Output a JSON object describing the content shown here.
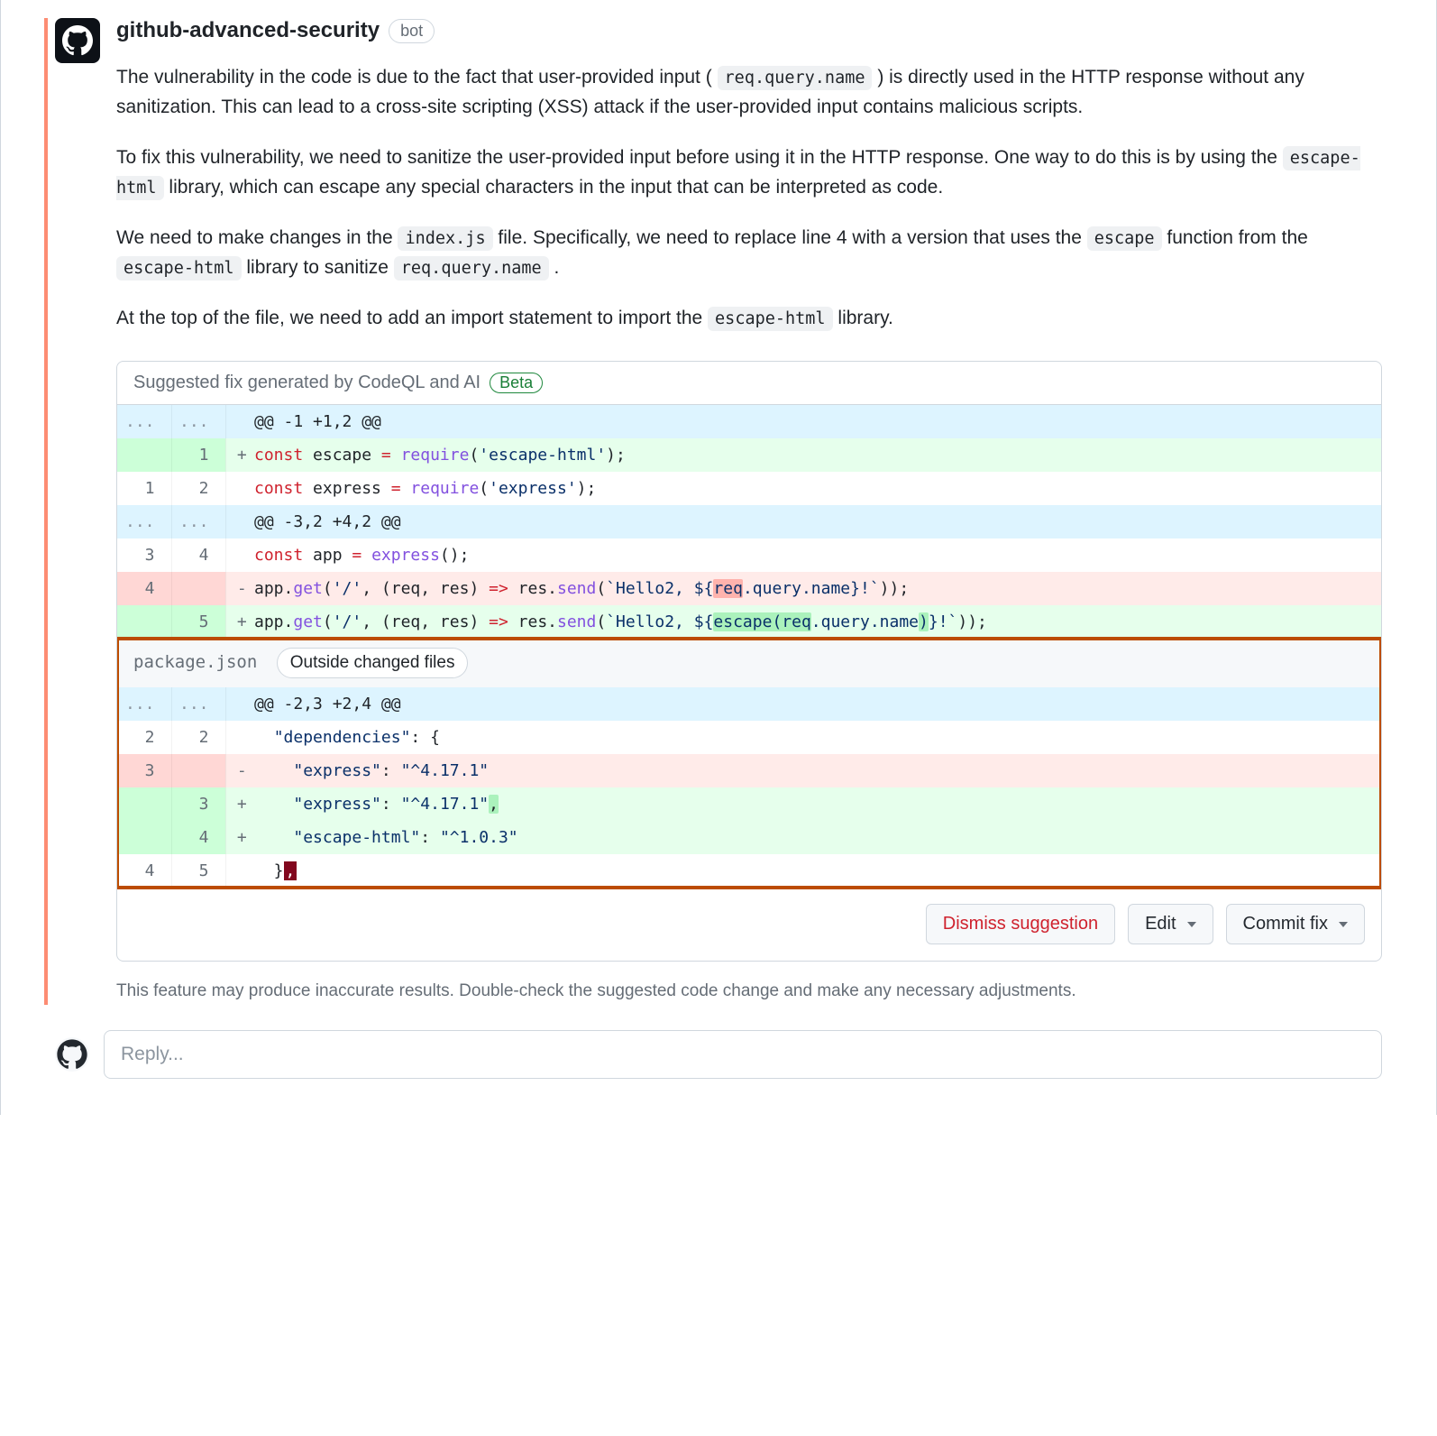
{
  "author": {
    "name": "github-advanced-security",
    "badge": "bot"
  },
  "body": {
    "p1a": "The vulnerability in the code is due to the fact that user-provided input ( ",
    "p1_code": "req.query.name",
    "p1b": " ) is directly used in the HTTP response without any sanitization. This can lead to a cross-site scripting (XSS) attack if the user-provided input contains malicious scripts.",
    "p2a": "To fix this vulnerability, we need to sanitize the user-provided input before using it in the HTTP response. One way to do this is by using the ",
    "p2_code": "escape-html",
    "p2b": " library, which can escape any special characters in the input that can be interpreted as code.",
    "p3a": "We need to make changes in the ",
    "p3_code1": "index.js",
    "p3b": " file. Specifically, we need to replace line 4 with a version that uses the ",
    "p3_code2": "escape",
    "p3c": " function from the ",
    "p3_code3": "escape-html",
    "p3d": " library to sanitize ",
    "p3_code4": "req.query.name",
    "p3e": " .",
    "p4a": "At the top of the file, we need to add an import statement to import the ",
    "p4_code": "escape-html",
    "p4b": " library."
  },
  "diff": {
    "header": "Suggested fix generated by CodeQL and AI",
    "beta": "Beta",
    "file2": "package.json",
    "outside_label": "Outside changed files",
    "rows1": [
      {
        "type": "hunk",
        "old": "...",
        "new": "...",
        "text_html": "@@ -1 +1,2 @@"
      },
      {
        "type": "add",
        "old": "",
        "new": "1",
        "text_html": "<span class='tok-kw'>const</span> escape <span class='tok-op'>=</span> <span class='tok-fn'>require</span>(<span class='tok-str'>'escape-html'</span>);"
      },
      {
        "type": "ctx",
        "old": "1",
        "new": "2",
        "text_html": "<span class='tok-kw'>const</span> express <span class='tok-op'>=</span> <span class='tok-fn'>require</span>(<span class='tok-str'>'express'</span>);"
      },
      {
        "type": "hunk",
        "old": "...",
        "new": "...",
        "text_html": "@@ -3,2 +4,2 @@"
      },
      {
        "type": "ctx",
        "old": "3",
        "new": "4",
        "text_html": "<span class='tok-kw'>const</span> app <span class='tok-op'>=</span> <span class='tok-fn'>express</span>();"
      },
      {
        "type": "del",
        "old": "4",
        "new": "",
        "text_html": "app.<span class='tok-fn'>get</span>(<span class='tok-str'>'/'</span>, (req, res) <span class='tok-op'>=&gt;</span> res.<span class='tok-fn'>send</span>(<span class='tok-str'>`Hello2, ${<span class='hl-del'>req</span>.query.name}!`</span>));"
      },
      {
        "type": "add",
        "old": "",
        "new": "5",
        "text_html": "app.<span class='tok-fn'>get</span>(<span class='tok-str'>'/'</span>, (req, res) <span class='tok-op'>=&gt;</span> res.<span class='tok-fn'>send</span>(<span class='tok-str'>`Hello2, ${<span class='hl-add'>escape(req</span>.query.name<span class='hl-add'>)</span>}!`</span>));"
      }
    ],
    "rows2": [
      {
        "type": "hunk",
        "old": "...",
        "new": "...",
        "text_html": "@@ -2,3 +2,4 @@"
      },
      {
        "type": "ctx",
        "old": "2",
        "new": "2",
        "text_html": "  <span class='tok-str'>\"dependencies\"</span>: {"
      },
      {
        "type": "del",
        "old": "3",
        "new": "",
        "text_html": "    <span class='tok-str'>\"express\"</span>: <span class='tok-str'>\"^4.17.1\"</span>"
      },
      {
        "type": "add",
        "old": "",
        "new": "3",
        "text_html": "    <span class='tok-str'>\"express\"</span>: <span class='tok-str'>\"^4.17.1\"</span><span class='hl-add'>,</span>"
      },
      {
        "type": "add",
        "old": "",
        "new": "4",
        "text_html": "    <span class='tok-str'>\"escape-html\"</span>: <span class='tok-str'>\"^1.0.3\"</span>"
      },
      {
        "type": "ctx",
        "old": "4",
        "new": "5",
        "text_html": "  }<span class='hl-red-after'>,</span>"
      }
    ]
  },
  "actions": {
    "dismiss": "Dismiss suggestion",
    "edit": "Edit",
    "commit": "Commit fix"
  },
  "disclaimer": "This feature may produce inaccurate results. Double-check the suggested code change and make any necessary adjustments.",
  "reply": {
    "placeholder": "Reply..."
  }
}
